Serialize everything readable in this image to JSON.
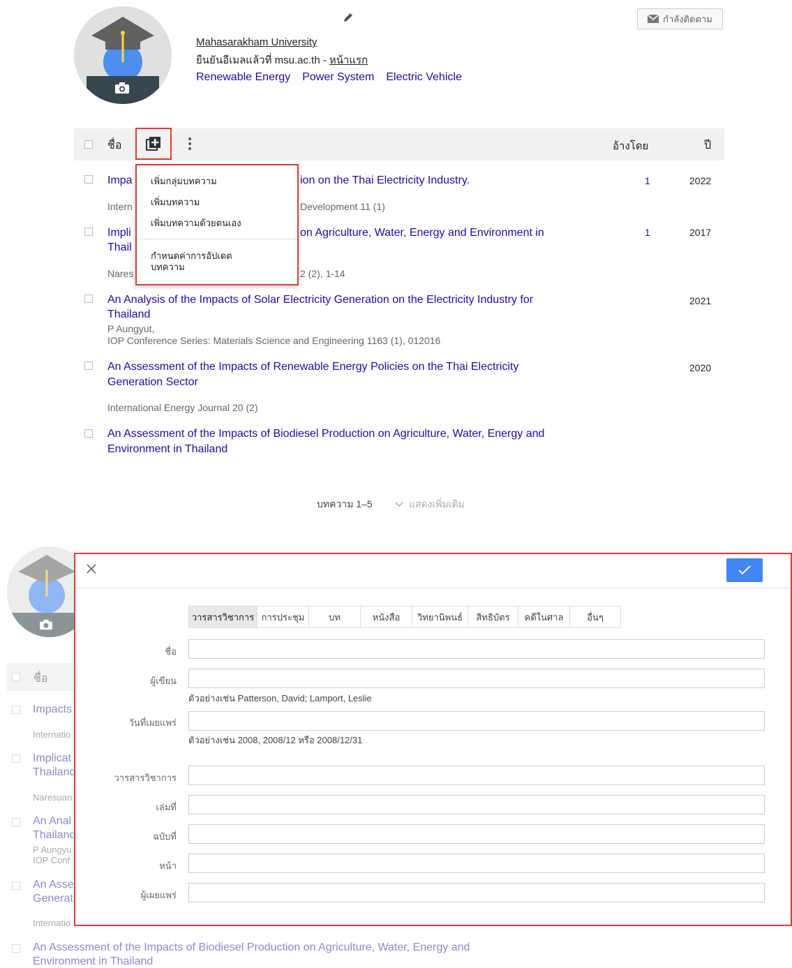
{
  "profile": {
    "university": "Mahasarakham University",
    "verified_prefix": "ยืนยันอีเมลแล้วที่ msu.ac.th -",
    "verified_home": "หน้าแรก",
    "interests": [
      "Renewable Energy",
      "Power System",
      "Electric Vehicle"
    ],
    "follow_label": "กำลังติดตาม"
  },
  "table": {
    "col_title": "ชื่อ",
    "col_cited": "อ้างโดย",
    "col_year": "ปี",
    "rows": [
      {
        "title_start": "Impa",
        "title_end": "ion on the Thai Electricity Industry.",
        "meta_start": "Intern",
        "meta_end": "Development 11 (1)",
        "cited": "1",
        "year": "2022"
      },
      {
        "title_start": "Impli",
        "title_start2": "Thail",
        "title_end": "on Agriculture, Water, Energy and Environment in",
        "meta_start": "Nares",
        "meta_end": "2 (2), 1-14",
        "cited": "1",
        "year": "2017"
      },
      {
        "title": "An Analysis of the Impacts of Solar Electricity Generation on the Electricity Industry for",
        "title2": "Thailand",
        "author": "P Aungyut,",
        "meta": "IOP Conference Series: Materials Science and Engineering 1163 (1), 012016",
        "year": "2021"
      },
      {
        "title": "An Assessment of the Impacts of Renewable Energy Policies on the Thai Electricity",
        "title2": "Generation Sector",
        "meta": "International Energy Journal 20 (2)",
        "year": "2020"
      },
      {
        "title": "An Assessment of the Impacts of Biodiesel Production on Agriculture, Water, Energy and",
        "title2": "Environment in Thailand"
      }
    ],
    "pager": "บทความ 1–5",
    "show_more": "แสดงเพิ่มเติม"
  },
  "menu": {
    "items": [
      "เพิ่มกลุ่มบทความ",
      "เพิ่มบทความ",
      "เพิ่มบทความด้วยตนเอง"
    ],
    "settings_line1": "กำหนดค่าการอัปเดต",
    "settings_line2": "บทความ"
  },
  "background": {
    "col_title": "ชื่อ",
    "rows": [
      {
        "t1": "Impacts",
        "m": "Internatio"
      },
      {
        "t1": "Implicat",
        "t2": "Thailand",
        "m": "Naresuan"
      },
      {
        "t1": "An Anal",
        "t2": "Thailand",
        "a": "P Aungyu",
        "m": "IOP Conf"
      },
      {
        "t1": "An Asse",
        "t2": "Generat",
        "m": "Internatio"
      }
    ],
    "last_title": "An Assessment of the Impacts of Biodiesel Production on Agriculture, Water, Energy and",
    "last_title2": "Environment in Thailand"
  },
  "dialog": {
    "tabs": [
      "วารสารวิชาการ",
      "การประชุม",
      "บท",
      "หนังสือ",
      "วิทยานิพนธ์",
      "สิทธิบัตร",
      "คดีในศาล",
      "อื่นๆ"
    ],
    "active_tab": "วารสารวิชาการ",
    "fields": {
      "title": "ชื่อ",
      "authors": "ผู้เขียน",
      "authors_hint": "ตัวอย่างเช่น Patterson, David; Lamport, Leslie",
      "date": "วันที่เผยแพร่",
      "date_hint": "ตัวอย่างเช่น 2008, 2008/12 หรือ 2008/12/31",
      "journal": "วารสารวิชาการ",
      "volume": "เล่มที่",
      "issue": "ฉบับที่",
      "pages": "หน้า",
      "publisher": "ผู้เผยแพร่"
    }
  },
  "colors": {
    "link": "#1a0dab",
    "highlight": "#e53935",
    "primary_button": "#4285f4"
  },
  "icons": [
    "camera-icon",
    "pencil-icon",
    "mail-icon",
    "add-library-icon",
    "kebab-icon",
    "close-icon",
    "check-icon",
    "chevron-down-icon"
  ]
}
